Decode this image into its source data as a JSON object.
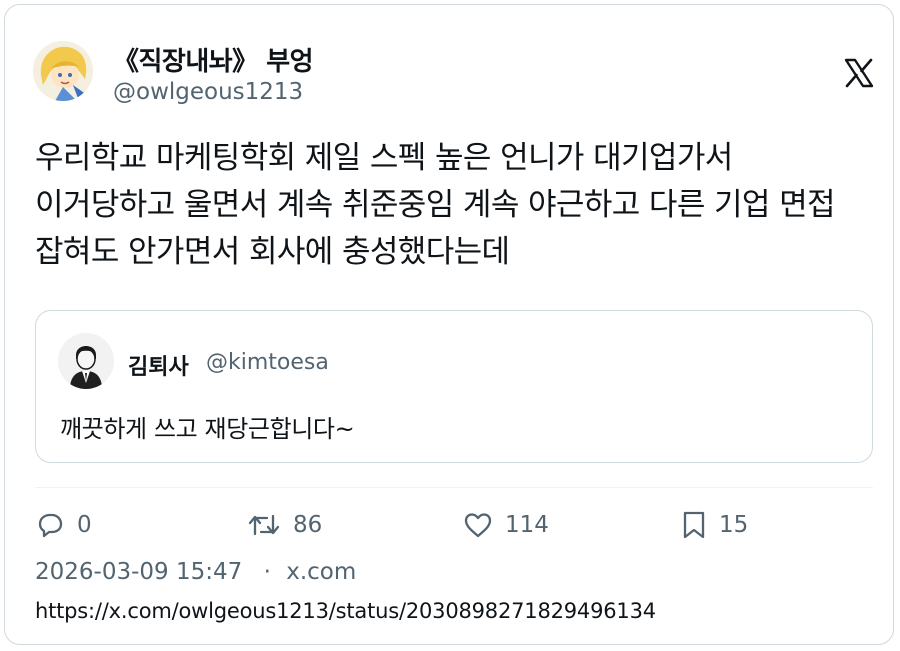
{
  "author": {
    "display_name": "《직장내놔》 부엉",
    "handle": "@owlgeous1213"
  },
  "tweet": {
    "text": "우리학교 마케팅학회 제일 스펙 높은 언니가 대기업가서 이거당하고 울면서 계속 취준중임 계속 야근하고 다른 기업 면접 잡혀도 안가면서 회사에 충성했다는데"
  },
  "quoted": {
    "display_name": "김퇴사",
    "handle": "@kimtoesa",
    "text": "깨끗하게 쓰고 재당근합니다~"
  },
  "actions": {
    "replies": "0",
    "retweets": "86",
    "likes": "114",
    "bookmarks": "15"
  },
  "meta": {
    "timestamp": "2026-03-09 15:47",
    "separator": "·",
    "source": "x.com",
    "url": "https://x.com/owlgeous1213/status/2030898271829496134"
  },
  "icons": {
    "logo": "x-logo-icon",
    "reply": "reply-icon",
    "retweet": "retweet-icon",
    "like": "heart-icon",
    "bookmark": "bookmark-icon"
  },
  "colors": {
    "text": "#0f1419",
    "secondary": "#536471",
    "border": "#cfd9de"
  }
}
